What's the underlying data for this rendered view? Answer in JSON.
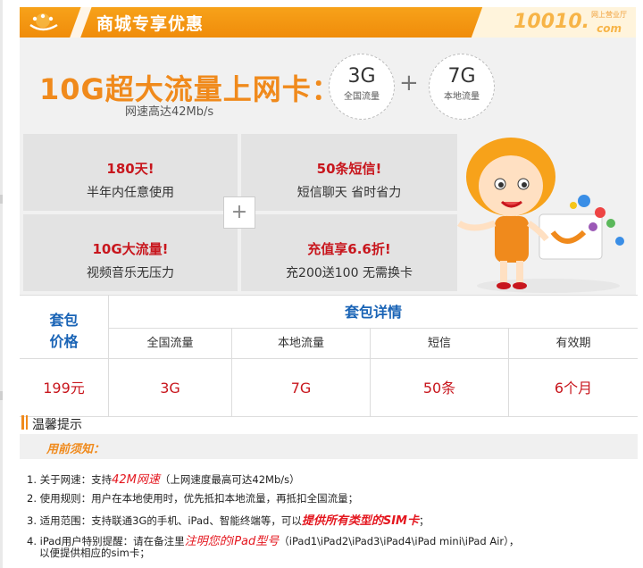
{
  "header": {
    "title": "商城专享优惠",
    "brand_number": "10010",
    "brand_dot": ".",
    "brand_com": "com",
    "brand_sub": "网上营业厅"
  },
  "promo": {
    "headline": "10G超大流量上网卡：",
    "subline": "网速高达42Mb/s",
    "bundles": [
      {
        "amount": "3G",
        "label": "全国流量"
      },
      {
        "amount": "7G",
        "label": "本地流量"
      }
    ],
    "plus": "+",
    "features": [
      {
        "title": "180天!",
        "desc": "半年内任意使用"
      },
      {
        "title": "50条短信!",
        "desc": "短信聊天  省时省力"
      },
      {
        "title": "10G大流量!",
        "desc": "视频音乐无压力"
      },
      {
        "title": "充值享6.6折!",
        "desc": "充200送100  无需换卡"
      }
    ],
    "center_plus": "+"
  },
  "package_table": {
    "price_header": [
      "套包",
      "价格"
    ],
    "details_header": "套包详情",
    "columns": [
      "全国流量",
      "本地流量",
      "短信",
      "有效期"
    ],
    "row": {
      "price": "199元",
      "values": [
        "3G",
        "7G",
        "50条",
        "6个月"
      ]
    }
  },
  "tips": {
    "title": "温馨提示",
    "notice": "用前须知：",
    "rules": [
      {
        "num": "1.",
        "a": "关于网速：支持",
        "hl": "42M网速",
        "b": "（上网速度最高可达42Mb/s）"
      },
      {
        "num": "2.",
        "a": "使用规则：用户在本地使用时，优先抵扣本地流量，再抵扣全国流量；",
        "hl": "",
        "b": ""
      },
      {
        "num": "3.",
        "a": "适用范围：支持联通3G的手机、iPad、智能终端等，可以",
        "hl": "提供所有类型的SIM卡",
        "b": "；"
      },
      {
        "num": "4.",
        "a": "iPad用户特别提醒：请在备注里",
        "hl": "注明您的iPad型号",
        "b": "（iPad1\\iPad2\\iPad3\\iPad4\\iPad mini\\iPad Air），"
      }
    ],
    "rule4_cont": "以便提供相应的sim卡；"
  },
  "colors": {
    "orange": "#f08a1c",
    "red": "#c8161d",
    "blue": "#1a64b6",
    "grey_bg": "#f1f1f1"
  }
}
